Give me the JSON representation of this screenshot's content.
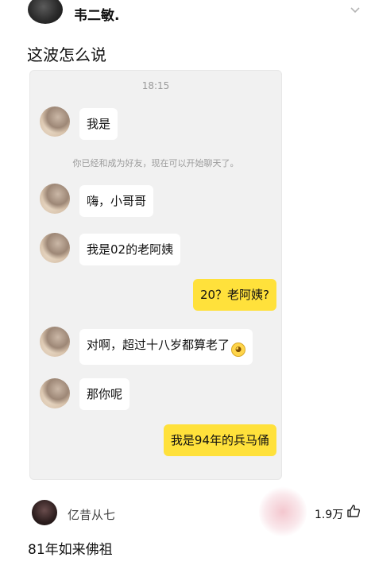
{
  "post": {
    "author": "韦二敏.",
    "text": "这波怎么说"
  },
  "chat": {
    "time": "18:15",
    "system_notice": "你已经和成为好友，现在可以开始聊天了。",
    "messages": [
      {
        "side": "left",
        "text": "我是"
      },
      {
        "side": "left",
        "text": "嗨，小哥哥"
      },
      {
        "side": "left",
        "text": "我是02的老阿姨"
      },
      {
        "side": "right",
        "text": "20？老阿姨?"
      },
      {
        "side": "left",
        "text": "对啊，超过十八岁都算老了"
      },
      {
        "side": "left",
        "text": "那你呢"
      },
      {
        "side": "right",
        "text": "我是94年的兵马俑"
      }
    ]
  },
  "comment": {
    "username": "亿昔从七",
    "likes": "1.9万",
    "text": "81年如来佛祖"
  },
  "icons": {
    "chevron": "chevron-down-icon",
    "like": "thumbs-up-icon",
    "emoji": "sweat-smile-emoji"
  },
  "colors": {
    "self_bubble": "#ffe13b",
    "other_bubble": "#ffffff",
    "chat_bg": "#f1f1f1"
  }
}
